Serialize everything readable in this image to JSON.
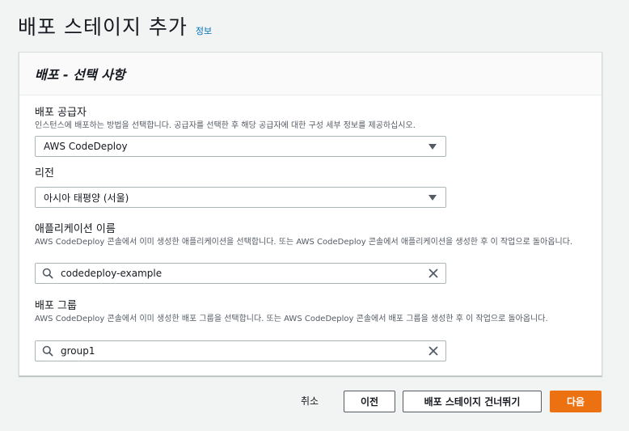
{
  "header": {
    "title": "배포 스테이지 추가",
    "info_link": "정보"
  },
  "card": {
    "title": "배포 - 선택 사항"
  },
  "fields": {
    "provider": {
      "label": "배포 공급자",
      "description": "인스턴스에 배포하는 방법을 선택합니다. 공급자를 선택한 후 해당 공급자에 대한 구성 세부 정보를 제공하십시오.",
      "value": "AWS CodeDeploy"
    },
    "region": {
      "label": "리전",
      "value": "아시아 태평양 (서울)"
    },
    "application": {
      "label": "애플리케이션 이름",
      "description": "AWS CodeDeploy 콘솔에서 이미 생성한 애플리케이션을 선택합니다. 또는 AWS CodeDeploy 콘솔에서 애플리케이션을 생성한 후 이 작업으로 돌아옵니다.",
      "value": "codedeploy-example"
    },
    "group": {
      "label": "배포 그룹",
      "description": "AWS CodeDeploy 콘솔에서 이미 생성한 배포 그룹을 선택합니다. 또는 AWS CodeDeploy 콘솔에서 배포 그룹을 생성한 후 이 작업으로 돌아옵니다.",
      "value": "group1"
    }
  },
  "actions": {
    "cancel": "취소",
    "previous": "이전",
    "skip": "배포 스테이지 건너뛰기",
    "next": "다음"
  },
  "colors": {
    "primary": "#ec7211",
    "link": "#0073bb",
    "background": "#f2f3f3"
  },
  "icons": {
    "select_caret": "caret-down-icon",
    "search": "search-icon",
    "clear": "clear-icon"
  }
}
